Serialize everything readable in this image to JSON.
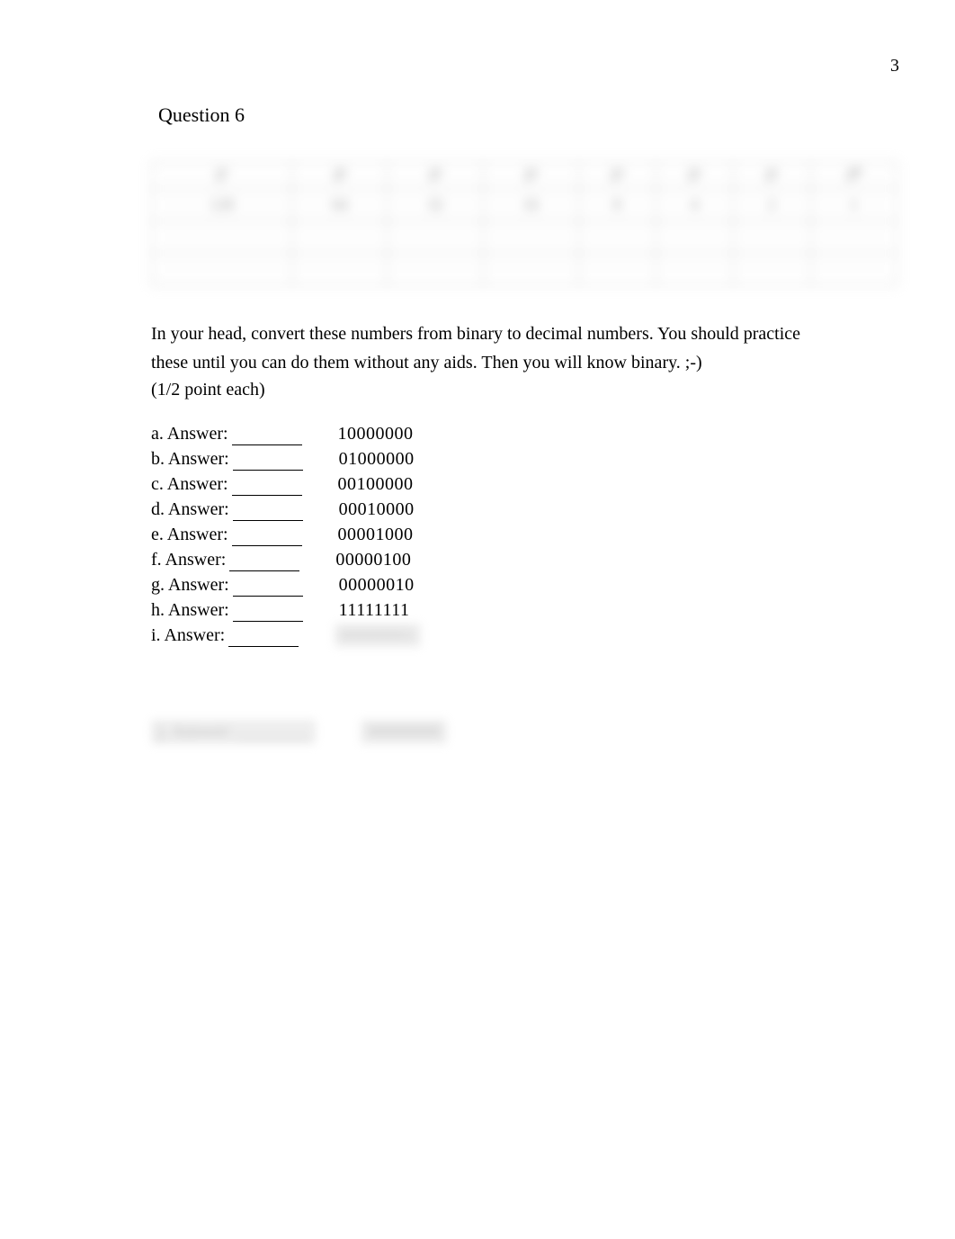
{
  "page_number": "3",
  "bullet_glyph": "",
  "question_title": "Question 6",
  "table": {
    "headers": [
      "2⁷",
      "2⁶",
      "2⁵",
      "2⁴",
      "2³",
      "2²",
      "2¹",
      "2⁰"
    ],
    "row2": [
      "128",
      "64",
      "32",
      "16",
      "8",
      "4",
      "2",
      "1"
    ],
    "row3": [
      "",
      "",
      "",
      "",
      "",
      "",
      "",
      ""
    ],
    "row4": [
      "",
      "",
      "",
      "",
      "",
      "",
      "",
      ""
    ]
  },
  "instruction_line1": "In your head, convert these numbers from binary to decimal numbers. You should practice",
  "instruction_line2": "these until you can do them without any aids. Then you will know binary. ;-)",
  "points": "(1/2 point each)",
  "answers": [
    {
      "label": "a. Answer:",
      "value": "10000000",
      "blurred": false
    },
    {
      "label": "b. Answer:",
      "value": "01000000",
      "blurred": false
    },
    {
      "label": "c. Answer:",
      "value": "00100000",
      "blurred": false
    },
    {
      "label": "d. Answer:",
      "value": "00010000",
      "blurred": false
    },
    {
      "label": "e. Answer:",
      "value": "00001000",
      "blurred": false
    },
    {
      "label": "f. Answer:",
      "value": "00000100",
      "blurred": false
    },
    {
      "label": "g. Answer:",
      "value": "00000010",
      "blurred": false
    },
    {
      "label": "h. Answer:",
      "value": "11111111",
      "blurred": false
    },
    {
      "label": "i. Answer:",
      "value": "00000001",
      "blurred": true
    }
  ],
  "bottom_blur_left": "j. Answer: ________",
  "bottom_blur_right": "00000000"
}
